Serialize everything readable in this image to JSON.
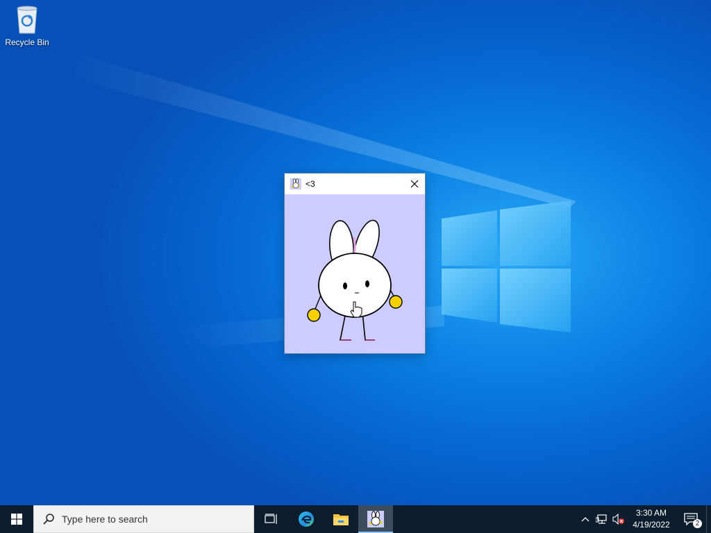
{
  "desktop": {
    "icons": [
      {
        "label": "Recycle Bin",
        "icon": "recycle-bin-icon"
      }
    ],
    "colors": {
      "wallpaper": "#0a78e0",
      "window_client": "#ccccff"
    }
  },
  "window": {
    "title": "<3",
    "icon": "bunny-icon",
    "close_icon": "close-icon"
  },
  "taskbar": {
    "start_icon": "windows-start-icon",
    "search_placeholder": "Type here to search",
    "apps": [
      {
        "name": "Task View",
        "icon": "task-view-icon",
        "active": false
      },
      {
        "name": "Microsoft Edge",
        "icon": "edge-icon",
        "active": false
      },
      {
        "name": "File Explorer",
        "icon": "folder-icon",
        "active": false
      },
      {
        "name": "<3",
        "icon": "bunny-icon",
        "active": true
      }
    ],
    "tray": {
      "icons": [
        "chevron-up-icon",
        "network-icon",
        "volume-muted-icon"
      ],
      "time": "3:30 AM",
      "date": "4/19/2022",
      "notification_count": "2"
    }
  }
}
